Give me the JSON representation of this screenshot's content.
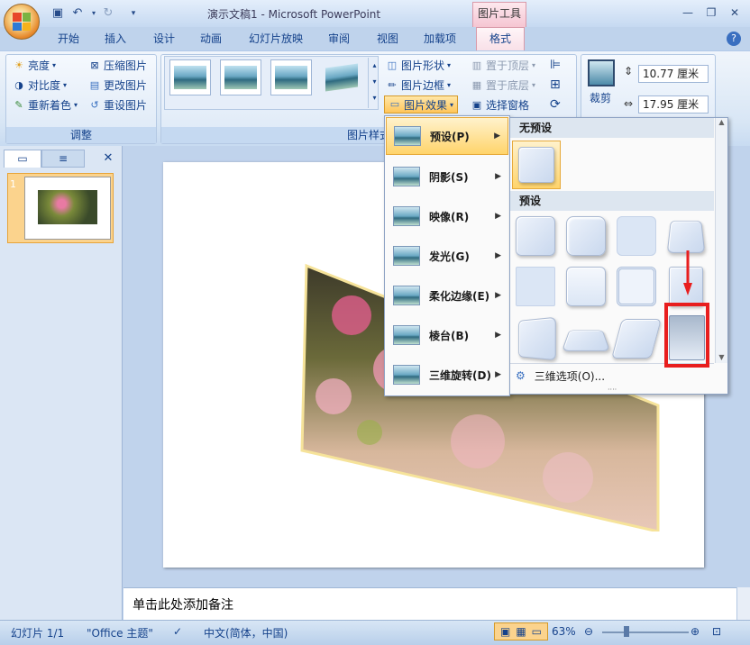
{
  "app": {
    "title": "演示文稿1 - Microsoft PowerPoint",
    "contextual_tab": "图片工具"
  },
  "tabs": [
    "开始",
    "插入",
    "设计",
    "动画",
    "幻灯片放映",
    "审阅",
    "视图",
    "加载项",
    "格式"
  ],
  "ribbon": {
    "adjust": {
      "label": "调整",
      "items": [
        "亮度",
        "对比度",
        "重新着色",
        "压缩图片",
        "更改图片",
        "重设图片"
      ]
    },
    "styles": {
      "label": "图片样式"
    },
    "picture_shape": "图片形状",
    "picture_border": "图片边框",
    "picture_effects": "图片效果",
    "arrange": {
      "bring_front": "置于顶层",
      "send_back": "置于底层",
      "selection_pane": "选择窗格"
    },
    "size": {
      "crop": "裁剪",
      "height": "10.77 厘米",
      "width": "17.95 厘米"
    }
  },
  "slide_panel": {
    "thumb_number": "1"
  },
  "effects_menu": {
    "items": [
      {
        "label": "预设(P)"
      },
      {
        "label": "阴影(S)"
      },
      {
        "label": "映像(R)"
      },
      {
        "label": "发光(G)"
      },
      {
        "label": "柔化边缘(E)"
      },
      {
        "label": "棱台(B)"
      },
      {
        "label": "三维旋转(D)"
      }
    ]
  },
  "preset_panel": {
    "no_preset_header": "无预设",
    "preset_header": "预设",
    "more_options": "三维选项(O)..."
  },
  "notes": {
    "placeholder": "单击此处添加备注"
  },
  "status": {
    "slide": "幻灯片 1/1",
    "theme": "\"Office 主题\"",
    "language": "中文(简体，中国)",
    "zoom": "63%"
  },
  "colors": {
    "accent": "#15428b",
    "highlight": "#ffd46b",
    "annotation": "#e81e1e"
  }
}
